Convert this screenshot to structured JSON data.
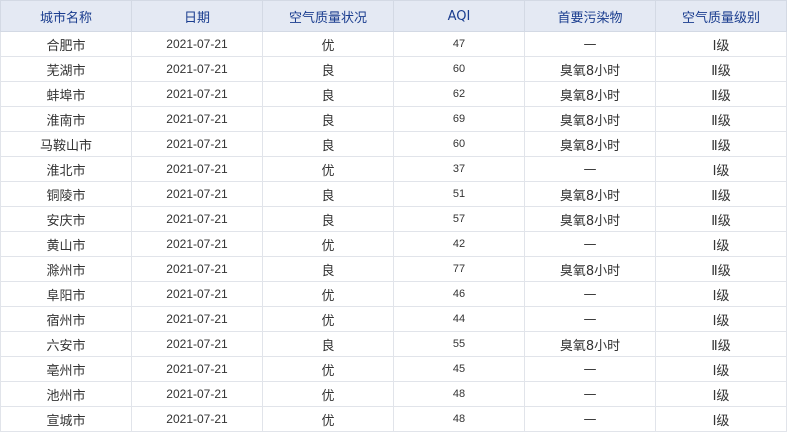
{
  "table": {
    "headers": [
      "城市名称",
      "日期",
      "空气质量状况",
      "AQI",
      "首要污染物",
      "空气质量级别"
    ],
    "rows": [
      {
        "city": "合肥市",
        "date": "2021-07-21",
        "status": "优",
        "aqi": "47",
        "pollutant": "—",
        "level": "Ⅰ级"
      },
      {
        "city": "芜湖市",
        "date": "2021-07-21",
        "status": "良",
        "aqi": "60",
        "pollutant": "臭氧8小时",
        "level": "Ⅱ级"
      },
      {
        "city": "蚌埠市",
        "date": "2021-07-21",
        "status": "良",
        "aqi": "62",
        "pollutant": "臭氧8小时",
        "level": "Ⅱ级"
      },
      {
        "city": "淮南市",
        "date": "2021-07-21",
        "status": "良",
        "aqi": "69",
        "pollutant": "臭氧8小时",
        "level": "Ⅱ级"
      },
      {
        "city": "马鞍山市",
        "date": "2021-07-21",
        "status": "良",
        "aqi": "60",
        "pollutant": "臭氧8小时",
        "level": "Ⅱ级"
      },
      {
        "city": "淮北市",
        "date": "2021-07-21",
        "status": "优",
        "aqi": "37",
        "pollutant": "—",
        "level": "Ⅰ级"
      },
      {
        "city": "铜陵市",
        "date": "2021-07-21",
        "status": "良",
        "aqi": "51",
        "pollutant": "臭氧8小时",
        "level": "Ⅱ级"
      },
      {
        "city": "安庆市",
        "date": "2021-07-21",
        "status": "良",
        "aqi": "57",
        "pollutant": "臭氧8小时",
        "level": "Ⅱ级"
      },
      {
        "city": "黄山市",
        "date": "2021-07-21",
        "status": "优",
        "aqi": "42",
        "pollutant": "—",
        "level": "Ⅰ级"
      },
      {
        "city": "滁州市",
        "date": "2021-07-21",
        "status": "良",
        "aqi": "77",
        "pollutant": "臭氧8小时",
        "level": "Ⅱ级"
      },
      {
        "city": "阜阳市",
        "date": "2021-07-21",
        "status": "优",
        "aqi": "46",
        "pollutant": "—",
        "level": "Ⅰ级"
      },
      {
        "city": "宿州市",
        "date": "2021-07-21",
        "status": "优",
        "aqi": "44",
        "pollutant": "—",
        "level": "Ⅰ级"
      },
      {
        "city": "六安市",
        "date": "2021-07-21",
        "status": "良",
        "aqi": "55",
        "pollutant": "臭氧8小时",
        "level": "Ⅱ级"
      },
      {
        "city": "亳州市",
        "date": "2021-07-21",
        "status": "优",
        "aqi": "45",
        "pollutant": "—",
        "level": "Ⅰ级"
      },
      {
        "city": "池州市",
        "date": "2021-07-21",
        "status": "优",
        "aqi": "48",
        "pollutant": "—",
        "level": "Ⅰ级"
      },
      {
        "city": "宣城市",
        "date": "2021-07-21",
        "status": "优",
        "aqi": "48",
        "pollutant": "—",
        "level": "Ⅰ级"
      }
    ]
  },
  "colors": {
    "header_bg": "#e4e9f3",
    "header_text": "#1a3d8f",
    "cell_text": "#333333",
    "border": "#e1e4ea"
  }
}
